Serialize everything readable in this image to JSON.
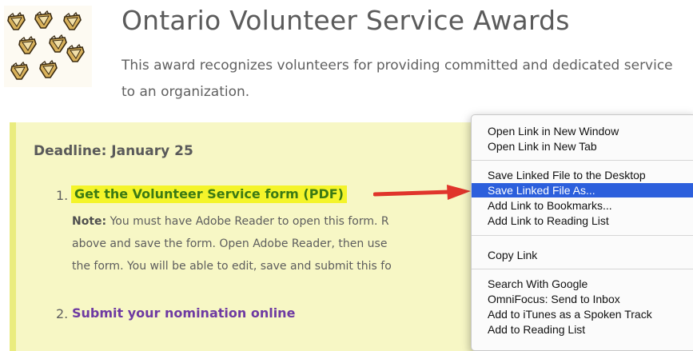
{
  "header": {
    "title": "Ontario Volunteer Service Awards",
    "description": "This award recognizes volunteers for providing committed and dedicated service to an organization."
  },
  "content": {
    "deadline": "Deadline: January 25",
    "steps": [
      {
        "number": "1.",
        "link_text": "Get the Volunteer Service form (PDF)",
        "note_label": "Note:",
        "note_lines": [
          " You must have Adobe Reader to open this form. R",
          "above and save the form. Open Adobe Reader, then use",
          "the form. You will be able to edit, save and submit this fo"
        ]
      },
      {
        "number": "2.",
        "link_text": "Submit your nomination online"
      }
    ]
  },
  "context_menu": {
    "groups": [
      [
        "Open Link in New Window",
        "Open Link in New Tab"
      ],
      [
        "Save Linked File to the Desktop",
        "Save Linked File As...",
        "Add Link to Bookmarks...",
        "Add Link to Reading List"
      ],
      [
        "Copy Link"
      ],
      [
        "Search With Google",
        "OmniFocus: Send to Inbox",
        "Add to iTunes as a Spoken Track",
        "Add to Reading List"
      ]
    ],
    "highlighted_item": "Save Linked File As..."
  },
  "colors": {
    "highlight_yellow": "#f4f42a",
    "box_background": "#f7f7c5",
    "link_green": "#3c7a14",
    "link_purple": "#6e3aa2",
    "menu_selection": "#2c5fdc",
    "arrow_red": "#e0352b"
  },
  "icons": [
    "award-pin-icon",
    "red-arrow-icon"
  ]
}
